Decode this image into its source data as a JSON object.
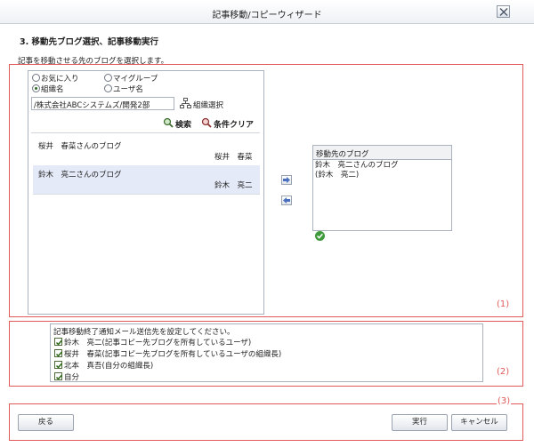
{
  "window": {
    "title": "記事移動/コピーウィザード"
  },
  "step": {
    "title": "3. 移動先ブログ選択、記事移動実行",
    "instruction": "記事を移動させる先のブログを選択します。"
  },
  "sections": {
    "label1": "(1)",
    "label2": "(2)",
    "label3": "(3)"
  },
  "filters": {
    "options": [
      {
        "label": "お気に入り",
        "selected": false
      },
      {
        "label": "マイグループ",
        "selected": false
      },
      {
        "label": "組織名",
        "selected": true
      },
      {
        "label": "ユーザ名",
        "selected": false
      }
    ],
    "org_value": "/株式会社ABCシステムズ/開発2部",
    "org_select_label": "組織選択",
    "search_label": "検索",
    "clear_label": "条件クリア"
  },
  "results": [
    {
      "title": "桜井　春菜さんのブログ",
      "owner": "桜井　春菜",
      "selected": false
    },
    {
      "title": "鈴木　亮二さんのブログ",
      "owner": "鈴木　亮二",
      "selected": true
    }
  ],
  "target": {
    "header": "移動先のブログ",
    "line1": "鈴木　亮二さんのブログ",
    "line2": "(鈴木　亮二)"
  },
  "notify": {
    "prompt": "記事移動終了通知メール送信先を設定してください。",
    "options": [
      {
        "label": "鈴木　亮二(記事コピー先ブログを所有しているユーザ)",
        "checked": true
      },
      {
        "label": "桜井　春菜(記事コピー先ブログを所有しているユーザの組織長)",
        "checked": true
      },
      {
        "label": "北本　真吾(自分の組織長)",
        "checked": true
      },
      {
        "label": "自分",
        "checked": true
      }
    ]
  },
  "buttons": {
    "back": "戻る",
    "execute": "実行",
    "cancel": "キャンセル"
  },
  "colors": {
    "section_border": "#e05a5a",
    "selected_row": "#e5eaf8",
    "check": "#3e9a3a"
  }
}
